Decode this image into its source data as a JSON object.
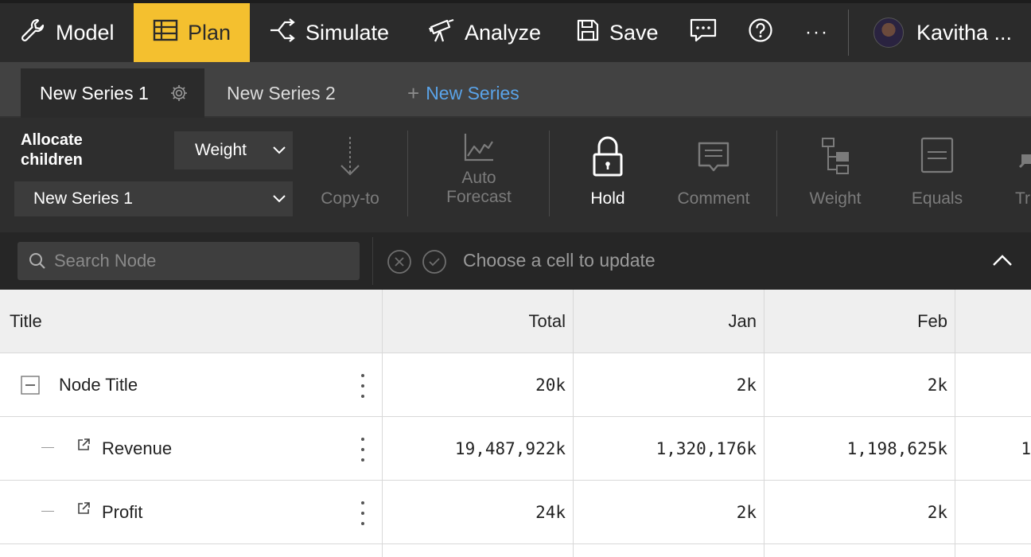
{
  "nav": {
    "model": "Model",
    "plan": "Plan",
    "simulate": "Simulate",
    "analyze": "Analyze",
    "save": "Save",
    "more": "···",
    "user": "Kavitha ..."
  },
  "series": {
    "tabs": [
      "New Series 1",
      "New Series 2"
    ],
    "new_series": "New Series"
  },
  "toolbar": {
    "allocate_title": "Allocate children",
    "method_value": "Weight",
    "series_value": "New Series 1",
    "tools": {
      "copy_to": "Copy-to",
      "auto_forecast": "Auto Forecast",
      "hold": "Hold",
      "comment": "Comment",
      "weight": "Weight",
      "equals": "Equals",
      "truncated": "Tr"
    }
  },
  "search": {
    "placeholder": "Search Node",
    "status": "Choose a cell to update"
  },
  "table": {
    "headers": [
      "Title",
      "Total",
      "Jan",
      "Feb"
    ],
    "rows": [
      {
        "title": "Node Title",
        "total": "20k",
        "jan": "2k",
        "feb": "2k",
        "next": ""
      },
      {
        "title": "Revenue",
        "total": "19,487,922k",
        "jan": "1,320,176k",
        "feb": "1,198,625k",
        "next": "1"
      },
      {
        "title": "Profit",
        "total": "24k",
        "jan": "2k",
        "feb": "2k",
        "next": ""
      }
    ]
  },
  "colors": {
    "plan_active": "#f4c02f",
    "nav_bg": "#2b2b2b",
    "link_blue": "#5aa3e8"
  }
}
